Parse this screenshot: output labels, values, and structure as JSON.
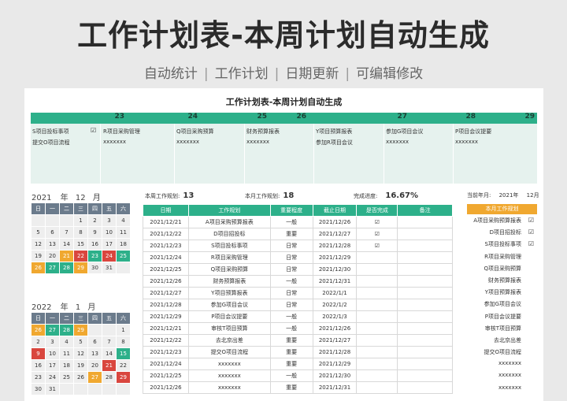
{
  "hero": {
    "title": "工作计划表-本周计划自动生成",
    "tags": [
      "自动统计",
      "工作计划",
      "日期更新",
      "可编辑修改"
    ],
    "sep": "|"
  },
  "sheet": {
    "title": "工作计划表-本周计划自动生成",
    "week_days": [
      "23",
      "24",
      "25",
      "26",
      "27",
      "28",
      "29"
    ],
    "week_items": [
      {
        "line1": "S项目投标事项",
        "check1": "☑",
        "line2": "提交O项目流程"
      },
      {
        "line1": "R项目采购管理",
        "check1": "",
        "line2": "xxxxxxx"
      },
      {
        "line1": "Q项目采购预算",
        "check1": "",
        "line2": "xxxxxxx"
      },
      {
        "line1": "财务预算报表",
        "check1": "",
        "line2": "xxxxxxx"
      },
      {
        "line1": "Y项目预算报表",
        "check1": "",
        "line2": "参加R项目会议"
      },
      {
        "line1": "参加G项目会议",
        "check1": "",
        "line2": "xxxxxxx"
      },
      {
        "line1": "P项目会议提要",
        "check1": "",
        "line2": "xxxxxxx"
      }
    ]
  },
  "cal1": {
    "year": "2021",
    "year_label": "年",
    "month": "12",
    "month_label": "月",
    "weekdays": [
      "日",
      "一",
      "二",
      "三",
      "四",
      "五",
      "六"
    ],
    "rows": [
      [
        "",
        "",
        "",
        "1",
        "2",
        "3",
        "4"
      ],
      [
        "5",
        "6",
        "7",
        "8",
        "9",
        "10",
        "11"
      ],
      [
        "12",
        "13",
        "14",
        "15",
        "16",
        "17",
        "18"
      ],
      [
        "19",
        "20",
        "21",
        "22",
        "23",
        "24",
        "25"
      ],
      [
        "26",
        "27",
        "28",
        "29",
        "30",
        "31",
        ""
      ]
    ]
  },
  "cal2": {
    "year": "2022",
    "year_label": "年",
    "month": "1",
    "month_label": "月",
    "weekdays": [
      "日",
      "一",
      "二",
      "三",
      "四",
      "五",
      "六"
    ],
    "rows": [
      [
        "26",
        "27",
        "28",
        "29",
        "",
        "",
        "1"
      ],
      [
        "2",
        "3",
        "4",
        "5",
        "6",
        "7",
        "8"
      ],
      [
        "9",
        "10",
        "11",
        "12",
        "13",
        "14",
        "15"
      ],
      [
        "16",
        "17",
        "18",
        "19",
        "20",
        "21",
        "22"
      ],
      [
        "23",
        "24",
        "25",
        "26",
        "27",
        "28",
        "29"
      ],
      [
        "30",
        "31",
        "",
        "",
        "",
        "",
        ""
      ]
    ]
  },
  "stats": {
    "week_label": "本周工作规划:",
    "week_value": "13",
    "month_label": "本月工作规划:",
    "month_value": "18",
    "progress_label": "完成进度:",
    "progress_value": "16.67%",
    "cur_label": "当前年月:",
    "cur_year": "2021年",
    "cur_month": "12月"
  },
  "table": {
    "headers": [
      "日期",
      "工作规划",
      "重要程度",
      "截止日期",
      "是否完成",
      "备注"
    ],
    "rows": [
      [
        "2021/12/21",
        "A项目采购预算报表",
        "一般",
        "2021/12/26",
        "☑",
        ""
      ],
      [
        "2021/12/22",
        "D项目招投标",
        "重要",
        "2021/12/27",
        "☑",
        ""
      ],
      [
        "2021/12/23",
        "S项目投标事项",
        "日常",
        "2021/12/28",
        "☑",
        ""
      ],
      [
        "2021/12/24",
        "R项目采购管理",
        "日常",
        "2021/12/29",
        "",
        ""
      ],
      [
        "2021/12/25",
        "Q项目采购预算",
        "日常",
        "2021/12/30",
        "",
        ""
      ],
      [
        "2021/12/26",
        "财务预算报表",
        "一般",
        "2021/12/31",
        "",
        ""
      ],
      [
        "2021/12/27",
        "Y项目预算报表",
        "日常",
        "2022/1/1",
        "",
        ""
      ],
      [
        "2021/12/28",
        "参加G项目会议",
        "日常",
        "2022/1/2",
        "",
        ""
      ],
      [
        "2021/12/29",
        "P项目会议提要",
        "一般",
        "2022/1/3",
        "",
        ""
      ],
      [
        "2021/12/21",
        "审核T项目预算",
        "一般",
        "2021/12/26",
        "",
        ""
      ],
      [
        "2021/12/22",
        "去北京出差",
        "重要",
        "2021/12/27",
        "",
        ""
      ],
      [
        "2021/12/23",
        "提交O项目流程",
        "重要",
        "2021/12/28",
        "",
        ""
      ],
      [
        "2021/12/24",
        "xxxxxxx",
        "重要",
        "2021/12/29",
        "",
        ""
      ],
      [
        "2021/12/25",
        "xxxxxxx",
        "一般",
        "2021/12/30",
        "",
        ""
      ],
      [
        "2021/12/26",
        "xxxxxxx",
        "重要",
        "2021/12/31",
        "",
        ""
      ]
    ]
  },
  "right_panel": {
    "header": "本月工作规划",
    "items": [
      {
        "text": "A项目采购预算报表",
        "check": "☑"
      },
      {
        "text": "D项目招投标",
        "check": "☑"
      },
      {
        "text": "S项目投标事项",
        "check": "☑"
      },
      {
        "text": "R项目采购管理",
        "check": ""
      },
      {
        "text": "Q项目采购预算",
        "check": ""
      },
      {
        "text": "财务预算报表",
        "check": ""
      },
      {
        "text": "Y项目预算报表",
        "check": ""
      },
      {
        "text": "参加G项目会议",
        "check": ""
      },
      {
        "text": "P项目会议提要",
        "check": ""
      },
      {
        "text": "审核T项目预算",
        "check": ""
      },
      {
        "text": "去北京出差",
        "check": ""
      },
      {
        "text": "提交O项目流程",
        "check": ""
      },
      {
        "text": "xxxxxxx",
        "check": ""
      },
      {
        "text": "xxxxxxx",
        "check": ""
      },
      {
        "text": "xxxxxxx",
        "check": ""
      }
    ]
  },
  "colors": {
    "teal": "#2db08a",
    "orange": "#f0a830",
    "red": "#d9463e",
    "slate": "#6b7b8c"
  }
}
